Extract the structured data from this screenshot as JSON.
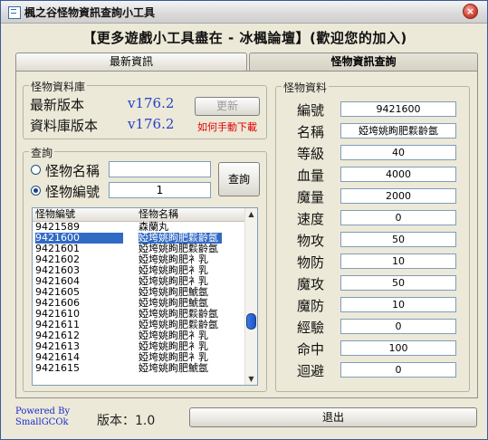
{
  "window": {
    "title": "楓之谷怪物資訊查詢小工具",
    "close_glyph": "×"
  },
  "banner": "【更多遊戲小工具盡在 - 冰楓論壇】(歡迎您的加入)",
  "tabs": [
    {
      "label": "最新資訊"
    },
    {
      "label": "怪物資訊查詢"
    }
  ],
  "database": {
    "title": "怪物資料庫",
    "latest_label": "最新版本",
    "latest_value": "v176.2",
    "db_label": "資料庫版本",
    "db_value": "v176.2",
    "update_button": "更新",
    "manual_link": "如何手動下載"
  },
  "query": {
    "title": "查詢",
    "by_name_label": "怪物名稱",
    "by_id_label": "怪物編號",
    "name_value": "",
    "id_value": "1",
    "query_button": "查詢"
  },
  "list": {
    "headers": [
      "怪物編號",
      "怪物名稱"
    ],
    "rows": [
      {
        "id": "9421589",
        "name": "森蘭丸"
      },
      {
        "id": "9421600",
        "name": "婭垮姚眗肥鬏齡氬",
        "selected": true
      },
      {
        "id": "9421601",
        "name": "婭垮姚眗肥鬏齡氬"
      },
      {
        "id": "9421602",
        "name": "婭垮姚眗肥衤乳"
      },
      {
        "id": "9421603",
        "name": "婭垮姚眗肥衤乳"
      },
      {
        "id": "9421604",
        "name": "婭垮姚眗肥衤乳"
      },
      {
        "id": "9421605",
        "name": "婭垮姚眗肥鯱氬"
      },
      {
        "id": "9421606",
        "name": "婭垮姚眗肥鯱氬"
      },
      {
        "id": "9421610",
        "name": "婭垮姚眗肥鬏齡氬"
      },
      {
        "id": "9421611",
        "name": "婭垮姚眗肥鬏齡氬"
      },
      {
        "id": "9421612",
        "name": "婭垮姚眗肥衤乳"
      },
      {
        "id": "9421613",
        "name": "婭垮姚眗肥衤乳"
      },
      {
        "id": "9421614",
        "name": "婭垮姚眗肥衤乳"
      },
      {
        "id": "9421615",
        "name": "婭垮姚眗肥鯱氬"
      }
    ]
  },
  "details": {
    "title": "怪物資料",
    "fields": [
      {
        "label": "編號",
        "value": "9421600"
      },
      {
        "label": "名稱",
        "value": "婭垮姚眗肥鬏齡氬"
      },
      {
        "label": "等級",
        "value": "40"
      },
      {
        "label": "血量",
        "value": "4000"
      },
      {
        "label": "魔量",
        "value": "2000"
      },
      {
        "label": "速度",
        "value": "0"
      },
      {
        "label": "物攻",
        "value": "50"
      },
      {
        "label": "物防",
        "value": "10"
      },
      {
        "label": "魔攻",
        "value": "50"
      },
      {
        "label": "魔防",
        "value": "10"
      },
      {
        "label": "經驗",
        "value": "0"
      },
      {
        "label": "命中",
        "value": "100"
      },
      {
        "label": "迴避",
        "value": "0"
      }
    ]
  },
  "footer": {
    "powered_line1": "Powered By",
    "powered_line2": "SmallGCOk",
    "version_text": "版本：1.0",
    "exit_button": "退出"
  }
}
